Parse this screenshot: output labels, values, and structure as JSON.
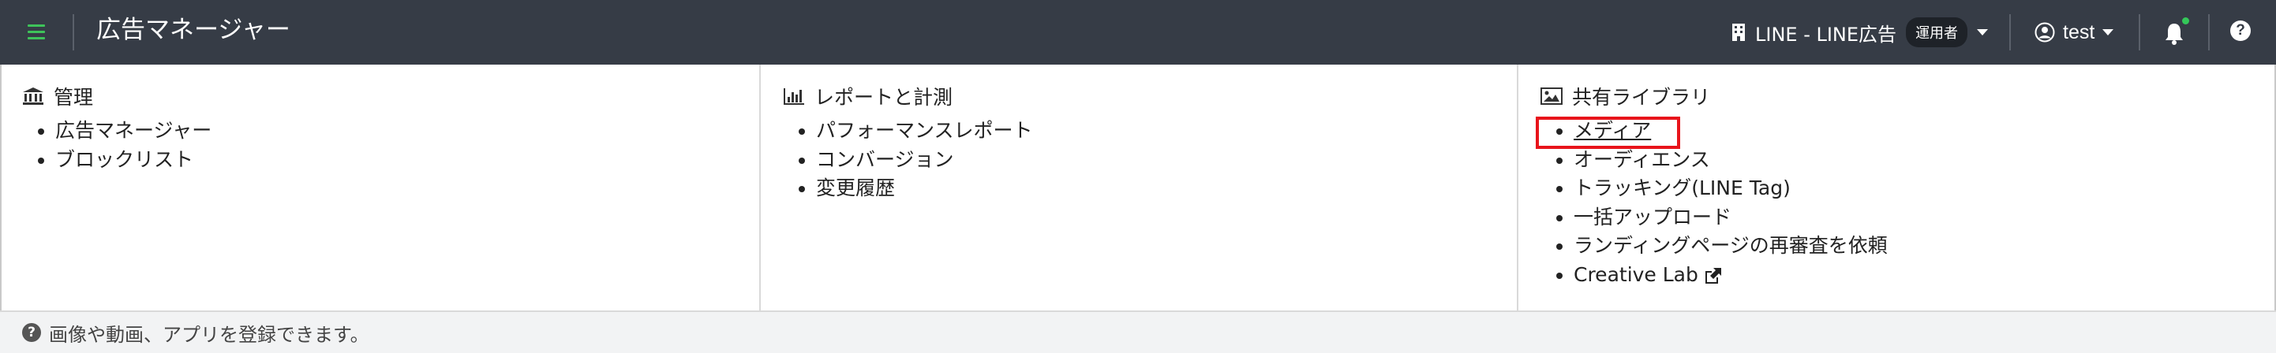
{
  "header": {
    "title": "広告マネージャー",
    "account_name": "LINE - LINE広告",
    "role_badge": "運用者",
    "user_name": "test",
    "accent_color": "#3ec35a",
    "bar_color": "#363c46"
  },
  "columns": [
    {
      "heading": "管理",
      "icon": "bank-icon",
      "items": [
        "広告マネージャー",
        "ブロックリスト"
      ]
    },
    {
      "heading": "レポートと計測",
      "icon": "bar-chart-icon",
      "items": [
        "パフォーマンスレポート",
        "コンバージョン",
        "変更履歴"
      ]
    },
    {
      "heading": "共有ライブラリ",
      "icon": "image-icon",
      "items": [
        "メディア",
        "オーディエンス",
        "トラッキング(LINE Tag)",
        "一括アップロード",
        "ランディングページの再審査を依頼",
        "Creative Lab"
      ]
    }
  ],
  "footer": {
    "help_text": "画像や動画、アプリを登録できます。"
  },
  "highlight_color": "#e8141b"
}
